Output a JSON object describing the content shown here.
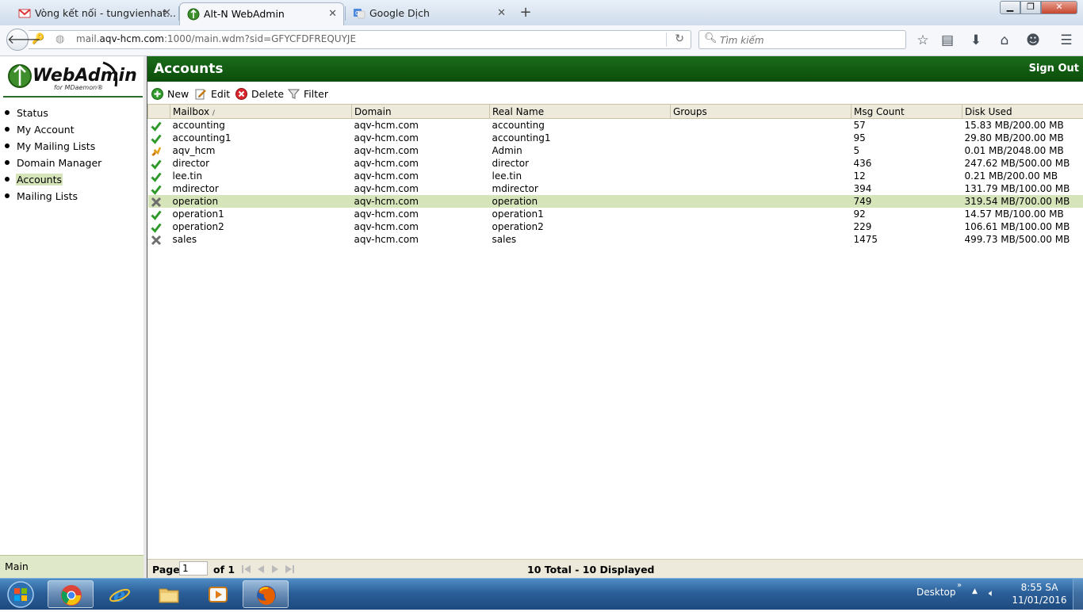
{
  "browser": {
    "tabs": [
      {
        "title": "Vòng kết nối - tungvienhat...",
        "icon": "gmail-icon",
        "active": false
      },
      {
        "title": "Alt-N WebAdmin",
        "icon": "webadmin-icon",
        "active": true
      },
      {
        "title": "Google Dịch",
        "icon": "google-translate-icon",
        "active": false
      }
    ],
    "url_prefix": "mail.",
    "url_host": "aqv-hcm.com",
    "url_rest": ":1000/main.wdm?sid=GFYCFDFREQUYJE",
    "search_placeholder": "Tìm kiếm"
  },
  "sidebar": {
    "logo_text": "WebAdmin",
    "logo_sub": "for MDaemon®",
    "items": [
      {
        "label": "Status",
        "selected": false
      },
      {
        "label": "My Account",
        "selected": false
      },
      {
        "label": "My Mailing Lists",
        "selected": false
      },
      {
        "label": "Domain Manager",
        "selected": false
      },
      {
        "label": "Accounts",
        "selected": true
      },
      {
        "label": "Mailing Lists",
        "selected": false
      }
    ],
    "footer": "Main"
  },
  "header": {
    "title": "Accounts",
    "sign_out": "Sign Out"
  },
  "toolbar": {
    "new_label": "New",
    "edit_label": "Edit",
    "delete_label": "Delete",
    "filter_label": "Filter"
  },
  "table": {
    "columns": [
      "Mailbox",
      "Domain",
      "Real Name",
      "Groups",
      "Msg Count",
      "Disk Used"
    ],
    "sort_indicator": "/",
    "rows": [
      {
        "status": "enabled",
        "mailbox": "accounting",
        "domain": "aqv-hcm.com",
        "real_name": "accounting",
        "groups": "",
        "msg_count": "57",
        "disk_used": "15.83 MB/200.00 MB"
      },
      {
        "status": "enabled",
        "mailbox": "accounting1",
        "domain": "aqv-hcm.com",
        "real_name": "accounting1",
        "groups": "",
        "msg_count": "95",
        "disk_used": "29.80 MB/200.00 MB"
      },
      {
        "status": "admin",
        "mailbox": "aqv_hcm",
        "domain": "aqv-hcm.com",
        "real_name": "Admin",
        "groups": "",
        "msg_count": "5",
        "disk_used": "0.01 MB/2048.00 MB"
      },
      {
        "status": "enabled",
        "mailbox": "director",
        "domain": "aqv-hcm.com",
        "real_name": "director",
        "groups": "",
        "msg_count": "436",
        "disk_used": "247.62 MB/500.00 MB"
      },
      {
        "status": "enabled",
        "mailbox": "lee.tin",
        "domain": "aqv-hcm.com",
        "real_name": "lee.tin",
        "groups": "",
        "msg_count": "12",
        "disk_used": "0.21 MB/200.00 MB"
      },
      {
        "status": "enabled",
        "mailbox": "mdirector",
        "domain": "aqv-hcm.com",
        "real_name": "mdirector",
        "groups": "",
        "msg_count": "394",
        "disk_used": "131.79 MB/100.00 MB"
      },
      {
        "status": "disabled",
        "mailbox": "operation",
        "domain": "aqv-hcm.com",
        "real_name": "operation",
        "groups": "",
        "msg_count": "749",
        "disk_used": "319.54 MB/700.00 MB",
        "highlighted": true
      },
      {
        "status": "enabled",
        "mailbox": "operation1",
        "domain": "aqv-hcm.com",
        "real_name": "operation1",
        "groups": "",
        "msg_count": "92",
        "disk_used": "14.57 MB/100.00 MB"
      },
      {
        "status": "enabled",
        "mailbox": "operation2",
        "domain": "aqv-hcm.com",
        "real_name": "operation2",
        "groups": "",
        "msg_count": "229",
        "disk_used": "106.61 MB/100.00 MB"
      },
      {
        "status": "disabled",
        "mailbox": "sales",
        "domain": "aqv-hcm.com",
        "real_name": "sales",
        "groups": "",
        "msg_count": "1475",
        "disk_used": "499.73 MB/500.00 MB"
      }
    ]
  },
  "pager": {
    "page_label": "Page",
    "page_value": "1",
    "of_label": "of 1",
    "totals": "10 Total - 10 Displayed"
  },
  "taskbar": {
    "desktop_label": "Desktop",
    "time": "8:55 SA",
    "date": "11/01/2016"
  },
  "colors": {
    "header_green": "#0f5a0f",
    "highlight": "#d6e4b9",
    "grid_header": "#eeeadb"
  }
}
